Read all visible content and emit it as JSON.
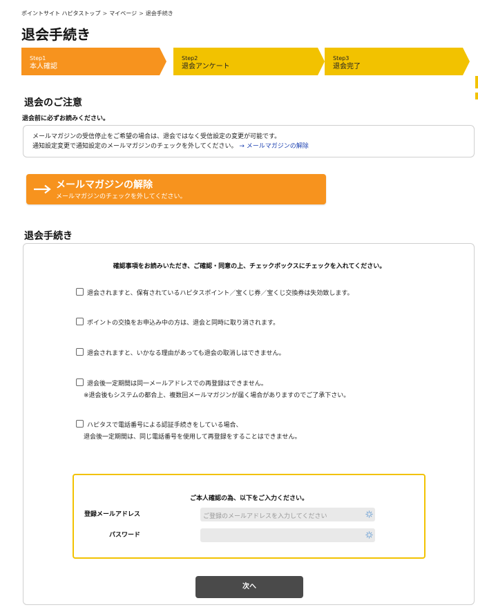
{
  "breadcrumb": {
    "items": [
      "ポイントサイト ハピタストップ",
      "マイページ",
      "退会手続き"
    ],
    "separator": ">"
  },
  "page_title": "退会手続き",
  "steps": [
    {
      "num": "Step1",
      "label": "本人確認",
      "state": "active"
    },
    {
      "num": "Step2",
      "label": "退会アンケート",
      "state": "inactive"
    },
    {
      "num": "Step3",
      "label": "退会完了",
      "state": "inactive"
    }
  ],
  "notice": {
    "heading": "退会のご注意",
    "subheading": "退会前に必ずお読みください。",
    "line1": "メールマガジンの受信停止をご希望の場合は、退会ではなく受信設定の変更が可能です。",
    "line2": "通知設定変更で通知設定のメールマガジンのチェックを外してください。",
    "link": "→ メールマガジンの解除"
  },
  "banner": {
    "title": "メールマガジンの解除",
    "subtitle": "メールマガジンのチェックを外してください。",
    "icon": "arrow-right-icon"
  },
  "withdrawal": {
    "heading": "退会手続き",
    "intro": "確認事項をお読みいただき、ご確認・同意の上、チェックボックスにチェックを入れてください。",
    "checks": [
      {
        "text": "退会されますと、保有されているハピタスポイント／宝くじ券／宝くじ交換券は失効致します。",
        "note": ""
      },
      {
        "text": "ポイントの交換をお申込み中の方は、退会と同時に取り消されます。",
        "note": ""
      },
      {
        "text": "退会されますと、いかなる理由があっても退会の取消しはできません。",
        "note": ""
      },
      {
        "text": "退会後一定期間は同一メールアドレスでの再登録はできません。",
        "note": "※退会後もシステムの都合上、複数回メールマガジンが届く場合がありますのでご了承下さい。"
      },
      {
        "text": "ハピタスで電話番号による認証手続きをしている場合、",
        "note": "退会後一定期間は、同じ電話番号を使用して再登録をすることはできません。"
      }
    ],
    "confirm": {
      "title": "ご本人確認の為、以下をご入力ください。",
      "email_label": "登録メールアドレス",
      "email_placeholder": "ご登録のメールアドレスを入力してください",
      "email_value": "",
      "password_label": "パスワード",
      "password_placeholder": "",
      "password_value": ""
    },
    "next_button": "次へ"
  },
  "colors": {
    "orange": "#f7931e",
    "yellow": "#f2c200",
    "link_blue": "#1a3fb0",
    "button_dark": "#4a4a4a"
  }
}
